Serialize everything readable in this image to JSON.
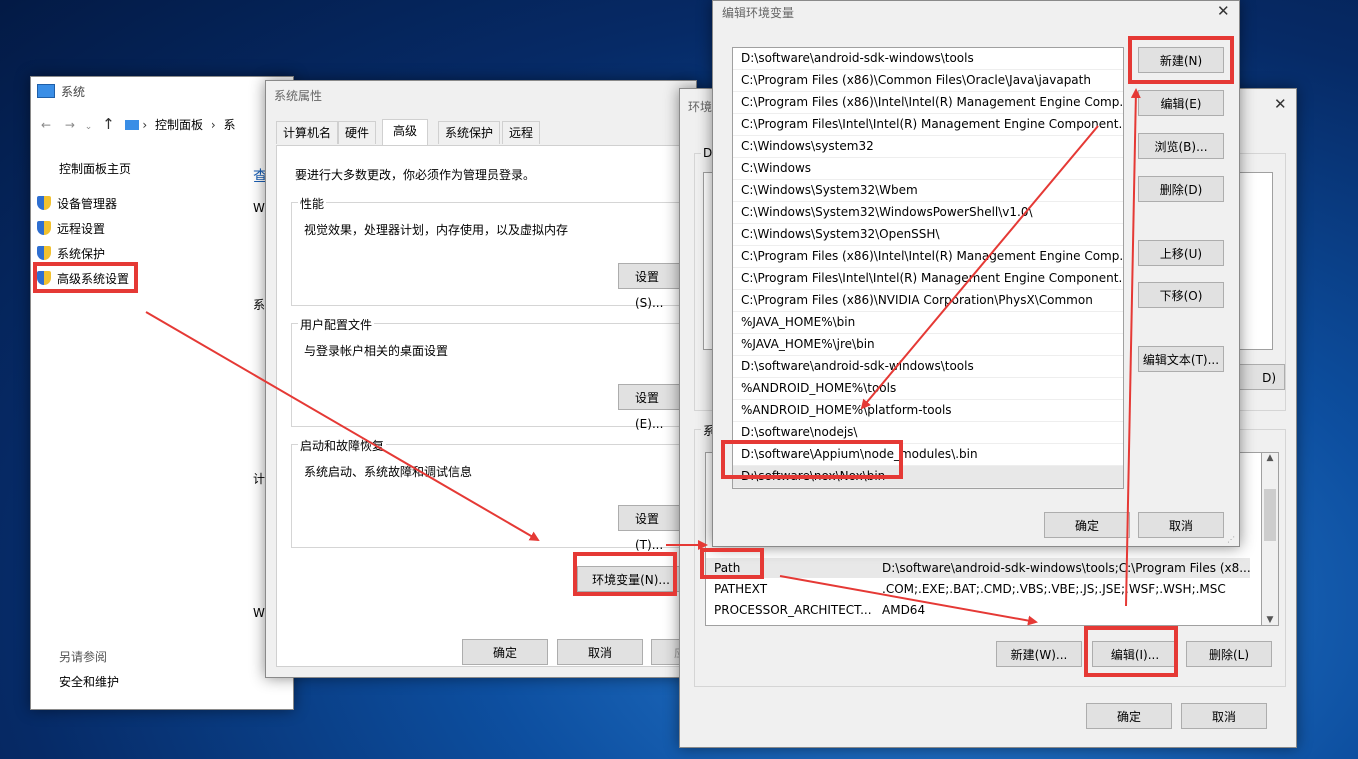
{
  "system": {
    "title": "系统",
    "breadcrumb": [
      "控制面板",
      "系"
    ],
    "nav_home": "控制面板主页",
    "nav_items": [
      "设备管理器",
      "远程设置",
      "系统保护",
      "高级系统设置"
    ],
    "see_also_title": "另请参阅",
    "see_also_item": "安全和维护",
    "cut_texts": [
      "查",
      "W",
      "系",
      "计",
      "W"
    ]
  },
  "sysprops": {
    "title": "系统属性",
    "tabs": [
      "计算机名",
      "硬件",
      "高级",
      "系统保护",
      "远程"
    ],
    "active_tab": "高级",
    "notice": "要进行大多数更改，你必须作为管理员登录。",
    "groups": [
      {
        "title": "性能",
        "desc": "视觉效果，处理器计划，内存使用，以及虚拟内存",
        "button": "设置(S)..."
      },
      {
        "title": "用户配置文件",
        "desc": "与登录帐户相关的桌面设置",
        "button": "设置(E)..."
      },
      {
        "title": "启动和故障恢复",
        "desc": "系统启动、系统故障和调试信息",
        "button": "设置(T)..."
      }
    ],
    "env_button": "环境变量(N)...",
    "ok": "确定",
    "cancel": "取消",
    "apply": "应"
  },
  "envvars": {
    "title": "环境",
    "section_user": "D",
    "section_sys": "系",
    "button_frag": "D)",
    "sys_vars": [
      {
        "name": "Path",
        "value": "D:\\software\\android-sdk-windows\\tools;C:\\Program Files (x8..."
      },
      {
        "name": "PATHEXT",
        "value": ".COM;.EXE;.BAT;.CMD;.VBS;.VBE;.JS;.JSE;.WSF;.WSH;.MSC"
      },
      {
        "name": "PROCESSOR_ARCHITECT...",
        "value": "AMD64"
      }
    ],
    "new": "新建(W)...",
    "edit": "编辑(I)...",
    "delete": "删除(L)",
    "ok": "确定",
    "cancel": "取消"
  },
  "editenv": {
    "title": "编辑环境变量",
    "entries": [
      "D:\\software\\android-sdk-windows\\tools",
      "C:\\Program Files (x86)\\Common Files\\Oracle\\Java\\javapath",
      "C:\\Program Files (x86)\\Intel\\Intel(R) Management Engine Comp...",
      "C:\\Program Files\\Intel\\Intel(R) Management Engine Component...",
      "C:\\Windows\\system32",
      "C:\\Windows",
      "C:\\Windows\\System32\\Wbem",
      "C:\\Windows\\System32\\WindowsPowerShell\\v1.0\\",
      "C:\\Windows\\System32\\OpenSSH\\",
      "C:\\Program Files (x86)\\Intel\\Intel(R) Management Engine Comp...",
      "C:\\Program Files\\Intel\\Intel(R) Management Engine Component...",
      "C:\\Program Files (x86)\\NVIDIA Corporation\\PhysX\\Common",
      "%JAVA_HOME%\\bin",
      "%JAVA_HOME%\\jre\\bin",
      "D:\\software\\android-sdk-windows\\tools",
      "%ANDROID_HOME%\\tools",
      "%ANDROID_HOME%\\platform-tools",
      "D:\\software\\nodejs\\",
      "D:\\software\\Appium\\node_modules\\.bin",
      "D:\\software\\nox\\Nox\\bin"
    ],
    "buttons": [
      "新建(N)",
      "编辑(E)",
      "浏览(B)...",
      "删除(D)",
      "上移(U)",
      "下移(O)",
      "编辑文本(T)..."
    ],
    "ok": "确定",
    "cancel": "取消"
  },
  "colors": {
    "annotation": "#e53935",
    "selected_row": "#e8e8e8"
  }
}
